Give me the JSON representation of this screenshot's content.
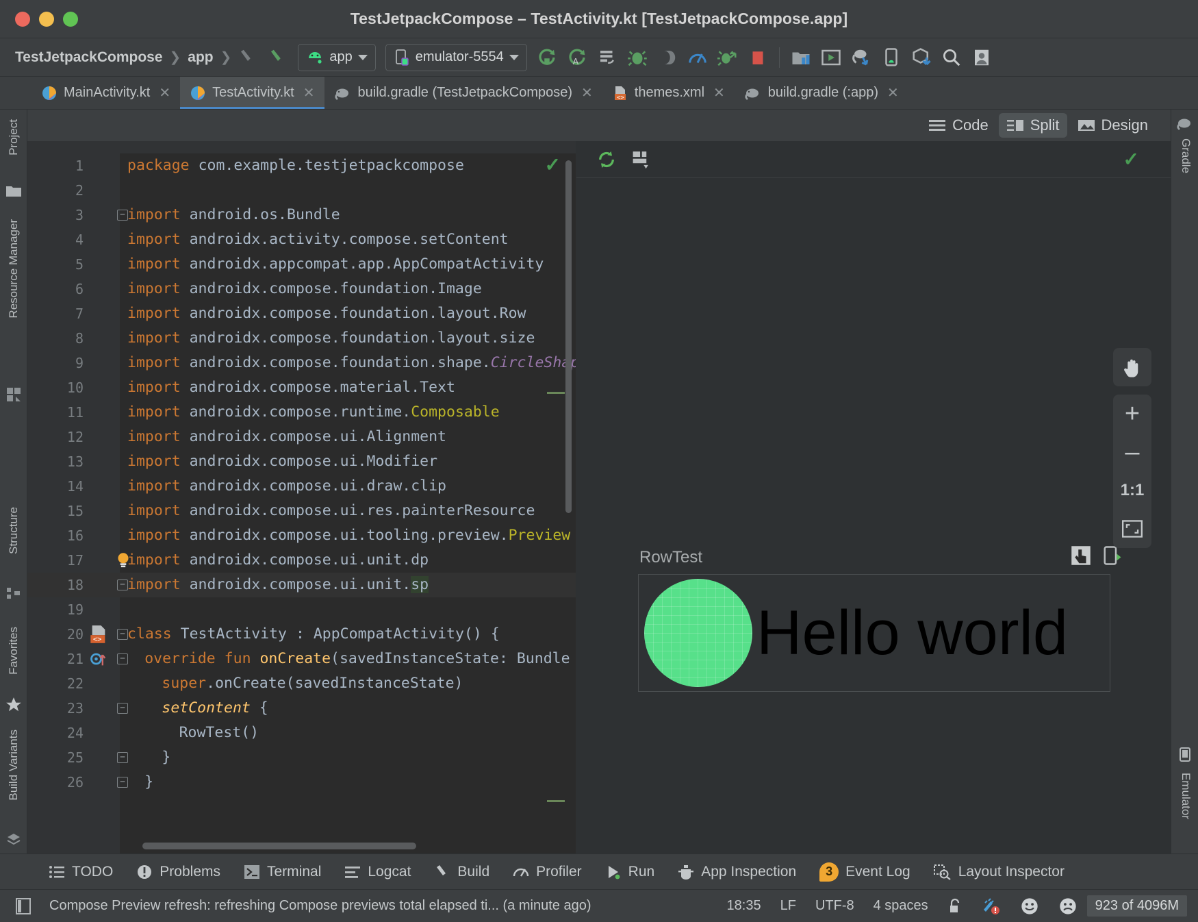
{
  "window": {
    "title": "TestJetpackCompose – TestActivity.kt [TestJetpackCompose.app]"
  },
  "toolbar": {
    "breadcrumbs": [
      "TestJetpackCompose",
      "app"
    ],
    "run_config": "app",
    "device": "emulator-5554",
    "icons": [
      "run-icon",
      "debug-run-icon",
      "apply-changes-icon",
      "debug-icon",
      "attach-debugger-icon",
      "profiler-icon",
      "run-with-coverage-icon",
      "stop-icon",
      "sdk-manager-icon",
      "avd-manager-icon",
      "gradle-sync-icon",
      "device-manager-icon",
      "build-icon",
      "search-icon",
      "account-icon"
    ]
  },
  "tabs": [
    {
      "label": "MainActivity.kt",
      "icon": "kotlin-file-icon",
      "active": false,
      "closable": true
    },
    {
      "label": "TestActivity.kt",
      "icon": "kotlin-file-icon",
      "active": true,
      "closable": true
    },
    {
      "label": "build.gradle (TestJetpackCompose)",
      "icon": "gradle-file-icon",
      "active": false,
      "closable": true
    },
    {
      "label": "themes.xml",
      "icon": "xml-file-icon",
      "active": false,
      "closable": true
    },
    {
      "label": "build.gradle (:app)",
      "icon": "gradle-file-icon",
      "active": false,
      "closable": false
    }
  ],
  "left_rail": [
    {
      "label": "Project"
    },
    {
      "label": "Resource Manager"
    },
    {
      "label": "Structure"
    },
    {
      "label": "Favorites"
    },
    {
      "label": "Build Variants"
    }
  ],
  "right_rail": [
    {
      "label": "Gradle"
    },
    {
      "label": "Emulator"
    }
  ],
  "view_modes": [
    {
      "label": "Code",
      "icon": "code-view-icon",
      "selected": false
    },
    {
      "label": "Split",
      "icon": "split-view-icon",
      "selected": true
    },
    {
      "label": "Design",
      "icon": "design-view-icon",
      "selected": false
    }
  ],
  "editor": {
    "lines": [
      {
        "n": 1,
        "segments": [
          {
            "t": "package ",
            "c": "kw"
          },
          {
            "t": "com.example.testjetpackcompose",
            "c": "pln"
          }
        ]
      },
      {
        "n": 2,
        "segments": []
      },
      {
        "n": 3,
        "fold": "minus",
        "segments": [
          {
            "t": "import ",
            "c": "kw"
          },
          {
            "t": "android.os.Bundle",
            "c": "pln"
          }
        ]
      },
      {
        "n": 4,
        "segments": [
          {
            "t": "import ",
            "c": "kw"
          },
          {
            "t": "androidx.activity.compose.setContent",
            "c": "pln"
          }
        ]
      },
      {
        "n": 5,
        "segments": [
          {
            "t": "import ",
            "c": "kw"
          },
          {
            "t": "androidx.appcompat.app.AppCompatActivity",
            "c": "pln"
          }
        ]
      },
      {
        "n": 6,
        "segments": [
          {
            "t": "import ",
            "c": "kw"
          },
          {
            "t": "androidx.compose.foundation.Image",
            "c": "pln"
          }
        ]
      },
      {
        "n": 7,
        "segments": [
          {
            "t": "import ",
            "c": "kw"
          },
          {
            "t": "androidx.compose.foundation.layout.Row",
            "c": "pln"
          }
        ]
      },
      {
        "n": 8,
        "segments": [
          {
            "t": "import ",
            "c": "kw"
          },
          {
            "t": "androidx.compose.foundation.layout.size",
            "c": "pln"
          }
        ]
      },
      {
        "n": 9,
        "segments": [
          {
            "t": "import ",
            "c": "kw"
          },
          {
            "t": "androidx.compose.foundation.shape.",
            "c": "pln"
          },
          {
            "t": "CircleShape",
            "c": "cls"
          }
        ]
      },
      {
        "n": 10,
        "segments": [
          {
            "t": "import ",
            "c": "kw"
          },
          {
            "t": "androidx.compose.material.Text",
            "c": "pln"
          }
        ]
      },
      {
        "n": 11,
        "segments": [
          {
            "t": "import ",
            "c": "kw"
          },
          {
            "t": "androidx.compose.runtime.",
            "c": "pln"
          },
          {
            "t": "Composable",
            "c": "ann"
          }
        ]
      },
      {
        "n": 12,
        "segments": [
          {
            "t": "import ",
            "c": "kw"
          },
          {
            "t": "androidx.compose.ui.Alignment",
            "c": "pln"
          }
        ]
      },
      {
        "n": 13,
        "segments": [
          {
            "t": "import ",
            "c": "kw"
          },
          {
            "t": "androidx.compose.ui.Modifier",
            "c": "pln"
          }
        ]
      },
      {
        "n": 14,
        "segments": [
          {
            "t": "import ",
            "c": "kw"
          },
          {
            "t": "androidx.compose.ui.draw.clip",
            "c": "pln"
          }
        ]
      },
      {
        "n": 15,
        "segments": [
          {
            "t": "import ",
            "c": "kw"
          },
          {
            "t": "androidx.compose.ui.res.painterResource",
            "c": "pln"
          }
        ]
      },
      {
        "n": 16,
        "segments": [
          {
            "t": "import ",
            "c": "kw"
          },
          {
            "t": "androidx.compose.ui.tooling.preview.",
            "c": "pln"
          },
          {
            "t": "Preview",
            "c": "ann"
          }
        ]
      },
      {
        "n": 17,
        "bulb": true,
        "segments": [
          {
            "t": "import ",
            "c": "kw"
          },
          {
            "t": "androidx.compose.ui.unit.dp",
            "c": "pln"
          }
        ]
      },
      {
        "n": 18,
        "active": true,
        "fold": "minus",
        "segments": [
          {
            "t": "import ",
            "c": "kw"
          },
          {
            "t": "androidx.compose.ui.unit.",
            "c": "pln"
          },
          {
            "t": "sp",
            "c": "hl-sp"
          }
        ]
      },
      {
        "n": 19,
        "segments": []
      },
      {
        "n": 20,
        "fold": "minus",
        "gutterIcon": "compose-preview-icon",
        "segments": [
          {
            "t": "class ",
            "c": "kw"
          },
          {
            "t": "TestActivity",
            "c": "pln"
          },
          {
            "t": " : AppCompatActivity() {",
            "c": "pln"
          }
        ]
      },
      {
        "n": 21,
        "fold": "minus",
        "gutterIcon": "override-method-icon",
        "indent": 1,
        "segments": [
          {
            "t": "override fun ",
            "c": "kw"
          },
          {
            "t": "onCreate",
            "c": "fn"
          },
          {
            "t": "(savedInstanceState: Bundle",
            "c": "pln"
          }
        ]
      },
      {
        "n": 22,
        "indent": 2,
        "segments": [
          {
            "t": "super",
            "c": "kw"
          },
          {
            "t": ".onCreate(savedInstanceState)",
            "c": "pln"
          }
        ]
      },
      {
        "n": 23,
        "fold": "minus",
        "indent": 2,
        "segments": [
          {
            "t": "setContent",
            "c": "fnit"
          },
          {
            "t": " {",
            "c": "pln"
          }
        ]
      },
      {
        "n": 24,
        "indent": 3,
        "segments": [
          {
            "t": "RowTest()",
            "c": "pln"
          }
        ]
      },
      {
        "n": 25,
        "fold": "minus",
        "indent": 2,
        "segments": [
          {
            "t": "}",
            "c": "pln"
          }
        ]
      },
      {
        "n": 26,
        "fold": "minus",
        "indent": 1,
        "segments": [
          {
            "t": "}",
            "c": "pln"
          }
        ]
      }
    ],
    "inspection_status": "ok"
  },
  "preview": {
    "toolbar_icons": [
      "refresh-preview-icon",
      "layout-mode-icon"
    ],
    "name": "RowTest",
    "action_icons": [
      "interactive-preview-icon",
      "deploy-preview-icon"
    ],
    "content": {
      "circle_color": "#57e08a",
      "text": "Hello world"
    },
    "zoom_controls": [
      {
        "name": "pan-tool-icon",
        "label": ""
      },
      {
        "name": "zoom-in-icon",
        "label": "+"
      },
      {
        "name": "zoom-out-icon",
        "label": "–"
      },
      {
        "name": "zoom-actual-icon",
        "label": "1:1"
      },
      {
        "name": "zoom-to-fit-icon",
        "label": ""
      }
    ],
    "status": "ok"
  },
  "tool_windows": [
    {
      "label": "TODO",
      "icon": "todo-icon"
    },
    {
      "label": "Problems",
      "icon": "problems-icon"
    },
    {
      "label": "Terminal",
      "icon": "terminal-icon"
    },
    {
      "label": "Logcat",
      "icon": "logcat-icon"
    },
    {
      "label": "Build",
      "icon": "build-icon"
    },
    {
      "label": "Profiler",
      "icon": "profiler-icon"
    },
    {
      "label": "Run",
      "icon": "run-icon"
    },
    {
      "label": "App Inspection",
      "icon": "app-inspection-icon"
    },
    {
      "label": "Event Log",
      "icon": "event-log-icon",
      "badge": "3"
    },
    {
      "label": "Layout Inspector",
      "icon": "layout-inspector-icon"
    }
  ],
  "status_bar": {
    "message": "Compose Preview refresh: refreshing Compose previews total elapsed ti... (a minute ago)",
    "time": "18:35",
    "line_separator": "LF",
    "encoding": "UTF-8",
    "indent": "4 spaces",
    "lock_icon": "unlocked-icon",
    "inspection_icon": "inspections-icon",
    "happy_icon": "happy-face-icon",
    "sad_icon": "sad-face-icon",
    "memory": "923 of 4096M"
  }
}
